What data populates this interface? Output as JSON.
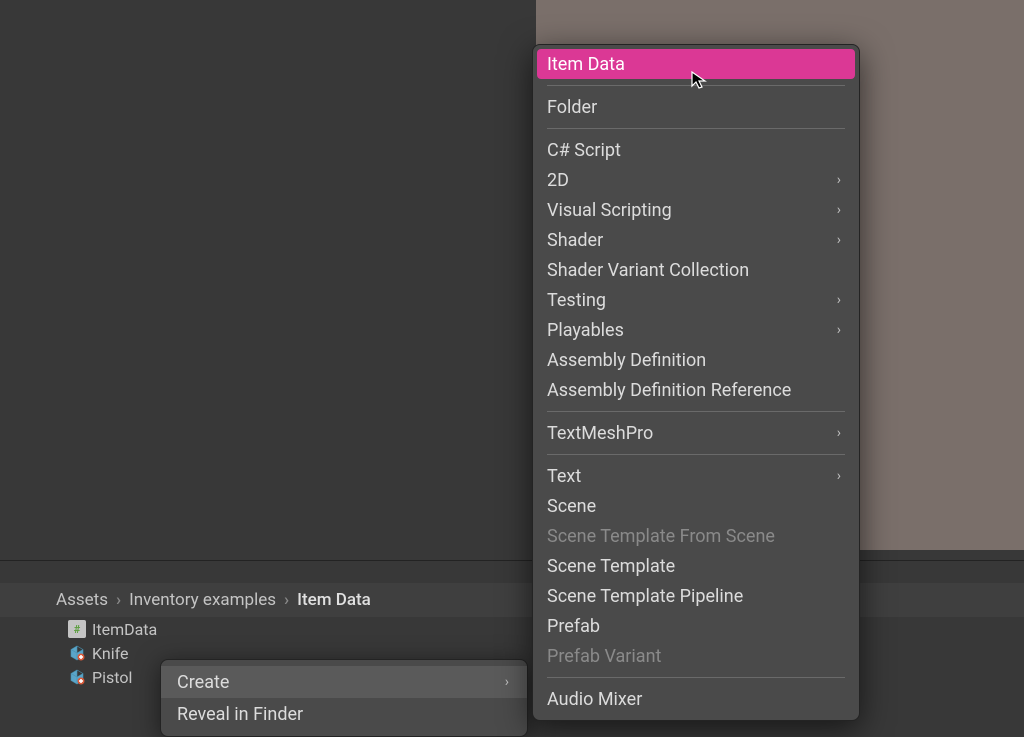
{
  "breadcrumb": {
    "root": "Assets",
    "mid": "Inventory examples",
    "current": "Item Data"
  },
  "assets": [
    {
      "name": "ItemData",
      "type": "script"
    },
    {
      "name": "Knife",
      "type": "prefab"
    },
    {
      "name": "Pistol",
      "type": "prefab"
    }
  ],
  "contextMenu": {
    "create_label": "Create",
    "reveal_label": "Reveal in Finder"
  },
  "createMenu": {
    "items": [
      {
        "label": "Item Data",
        "selected": true
      },
      {
        "sep": true
      },
      {
        "label": "Folder"
      },
      {
        "sep": true
      },
      {
        "label": "C# Script"
      },
      {
        "label": "2D",
        "submenu": true
      },
      {
        "label": "Visual Scripting",
        "submenu": true
      },
      {
        "label": "Shader",
        "submenu": true
      },
      {
        "label": "Shader Variant Collection"
      },
      {
        "label": "Testing",
        "submenu": true
      },
      {
        "label": "Playables",
        "submenu": true
      },
      {
        "label": "Assembly Definition"
      },
      {
        "label": "Assembly Definition Reference"
      },
      {
        "sep": true
      },
      {
        "label": "TextMeshPro",
        "submenu": true
      },
      {
        "sep": true
      },
      {
        "label": "Text",
        "submenu": true
      },
      {
        "label": "Scene"
      },
      {
        "label": "Scene Template From Scene",
        "disabled": true
      },
      {
        "label": "Scene Template"
      },
      {
        "label": "Scene Template Pipeline"
      },
      {
        "label": "Prefab"
      },
      {
        "label": "Prefab Variant",
        "disabled": true
      },
      {
        "sep": true
      },
      {
        "label": "Audio Mixer"
      }
    ]
  }
}
